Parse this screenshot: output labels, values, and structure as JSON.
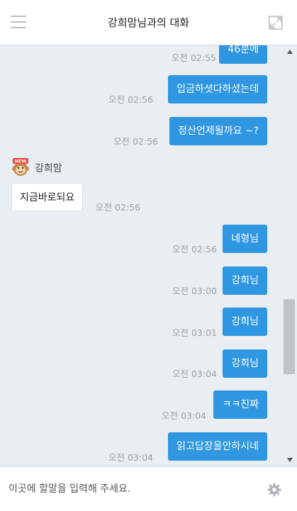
{
  "header": {
    "title": "강희맘님과의 대화"
  },
  "messages": [
    {
      "dir": "out",
      "text": "46분에",
      "time": "오전 02:55"
    },
    {
      "dir": "out",
      "text": "입금하셧다하셨는데",
      "time": "오전 02:56"
    },
    {
      "dir": "out",
      "text": "정산언제될까요 ~?",
      "time": "오전 02:56"
    },
    {
      "dir": "in",
      "sender": "강희맘",
      "avatar_badge": "NEW",
      "text": "지금바로되요",
      "time": "오전 02:56"
    },
    {
      "dir": "out",
      "text": "네형님",
      "time": "오전 02:56"
    },
    {
      "dir": "out",
      "text": "강희님",
      "time": "오전 03:00"
    },
    {
      "dir": "out",
      "text": "강희님",
      "time": "오전 03:01"
    },
    {
      "dir": "out",
      "text": "강희님",
      "time": "오전 03:04"
    },
    {
      "dir": "out",
      "text": "ㅋㅋ진짜",
      "time": "오전 03:04"
    },
    {
      "dir": "out",
      "text": "읽고답장을안하시네",
      "time": "오전 03:04"
    }
  ],
  "composer": {
    "placeholder": "이곳에 할말을 입력해 주세요."
  },
  "icons": {
    "menu": "hamburger-menu-icon",
    "expand": "expand-window-icon",
    "settings": "gear-icon",
    "avatar": "monkey-avatar-icon"
  },
  "colors": {
    "accent": "#2f96e1",
    "chat_bg": "#e9eef2"
  }
}
